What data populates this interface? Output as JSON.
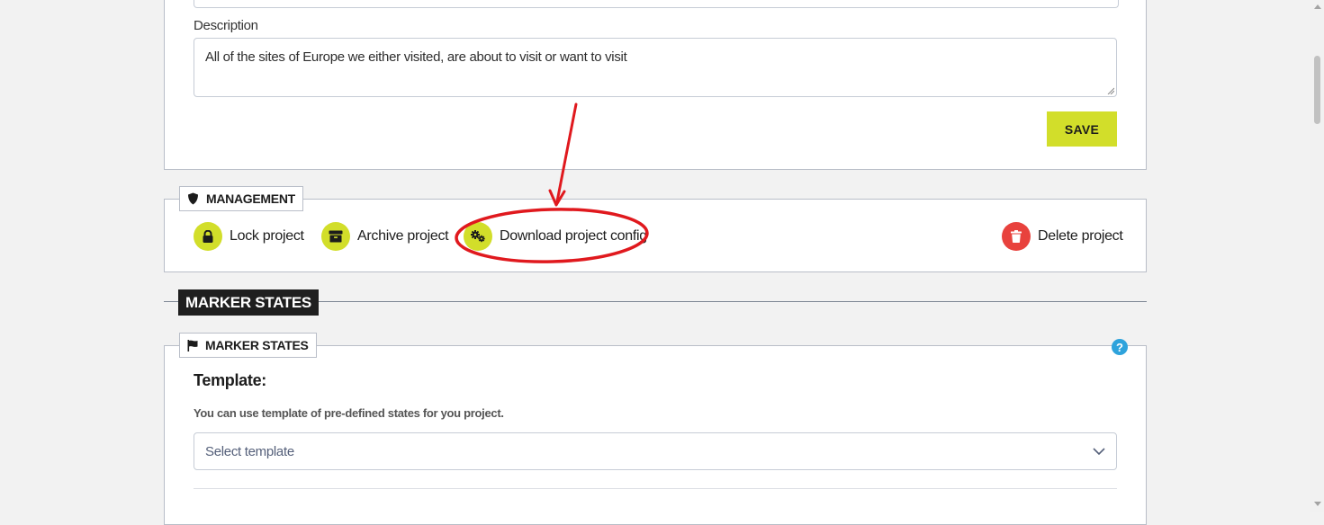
{
  "description": {
    "label": "Description",
    "value": "All of the sites of Europe we either visited, are about to visit or want to visit"
  },
  "save_label": "SAVE",
  "management": {
    "title": "MANAGEMENT",
    "lock": "Lock project",
    "archive": "Archive project",
    "download": "Download project config",
    "delete": "Delete project"
  },
  "section_title": "MARKER STATES",
  "marker_states": {
    "legend": "MARKER STATES",
    "help": "?",
    "template_heading": "Template:",
    "template_hint": "You can use template of pre-defined states for you project.",
    "select_placeholder": "Select template"
  },
  "colors": {
    "accent": "#d2de2a",
    "danger": "#e8423d",
    "annotation": "#e0191e",
    "help": "#2ea3dc"
  }
}
